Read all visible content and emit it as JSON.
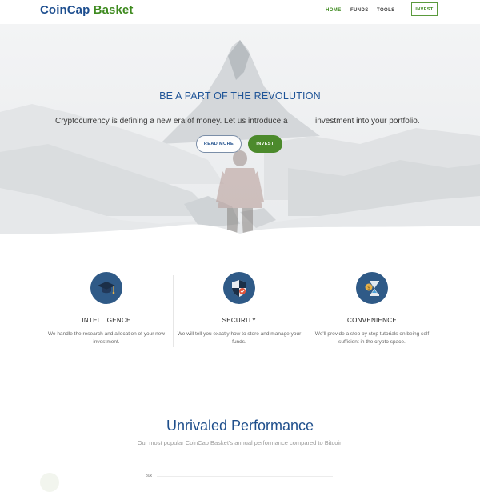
{
  "nav": {
    "logo_part1": "CoinCap",
    "logo_part2": "Basket",
    "links": [
      "HOME",
      "FUNDS",
      "TOOLS"
    ],
    "invest_button": "INVEST",
    "accent_color": "#3e8a1f",
    "brand_color": "#1d4e8f"
  },
  "hero": {
    "title": "BE A PART OF THE REVOLUTION",
    "text_part1": "Cryptocurrency is defining a new era of money. Let us introduce a",
    "text_part2": "investment into your portfolio.",
    "read_more_button": "READ MORE",
    "invest_button": "INVEST"
  },
  "features": [
    {
      "icon": "graduation-cap-icon",
      "title": "INTELLIGENCE",
      "desc": "We handle the research and allocation of your new investment."
    },
    {
      "icon": "shield-check-icon",
      "title": "SECURITY",
      "desc": "We will tell you exactly how to store and manage your funds."
    },
    {
      "icon": "hourglass-coin-icon",
      "title": "CONVENIENCE",
      "desc": "We'll provide a step by step tutorials on being self sufficient in the crypto space."
    }
  ],
  "performance": {
    "title": "Unrivaled Performance",
    "subtitle": "Our most popular CoinCap Basket's annual performance compared to Bitcoin",
    "first_tick": "30k"
  }
}
